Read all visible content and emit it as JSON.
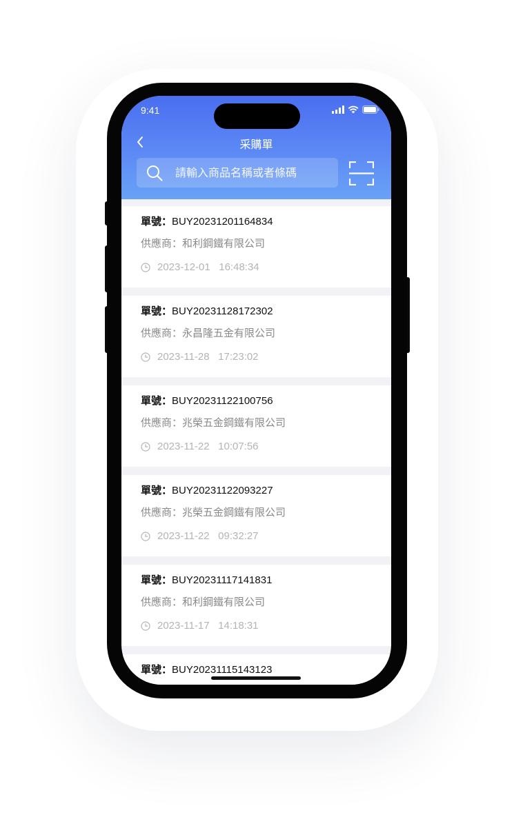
{
  "status_bar": {
    "time": "9:41"
  },
  "nav": {
    "title": "采購單"
  },
  "search": {
    "placeholder": "請輸入商品名稱或者條碼"
  },
  "labels": {
    "order_prefix": "單號：",
    "supplier_prefix": "供應商："
  },
  "orders": [
    {
      "order_no": "BUY20231201164834",
      "supplier": "和利鋼鐵有限公司",
      "date": "2023-12-01",
      "time": "16:48:34"
    },
    {
      "order_no": "BUY20231128172302",
      "supplier": "永昌隆五金有限公司",
      "date": "2023-11-28",
      "time": "17:23:02"
    },
    {
      "order_no": "BUY20231122100756",
      "supplier": "兆榮五金鋼鐵有限公司",
      "date": "2023-11-22",
      "time": "10:07:56"
    },
    {
      "order_no": "BUY20231122093227",
      "supplier": "兆榮五金鋼鐵有限公司",
      "date": "2023-11-22",
      "time": "09:32:27"
    },
    {
      "order_no": "BUY20231117141831",
      "supplier": "和利鋼鐵有限公司",
      "date": "2023-11-17",
      "time": "14:18:31"
    },
    {
      "order_no": "BUY20231115143123",
      "supplier": "",
      "date": "",
      "time": ""
    }
  ],
  "colors": {
    "header_top": "#4a6ef0",
    "header_bottom": "#6aa2f7",
    "page_bg": "#f1f1f6",
    "card_bg": "#ffffff",
    "muted_text": "#8a8a8a"
  },
  "icons": [
    "back-icon",
    "search-icon",
    "scan-icon",
    "clock-icon",
    "signal-icon",
    "wifi-icon",
    "battery-icon"
  ]
}
